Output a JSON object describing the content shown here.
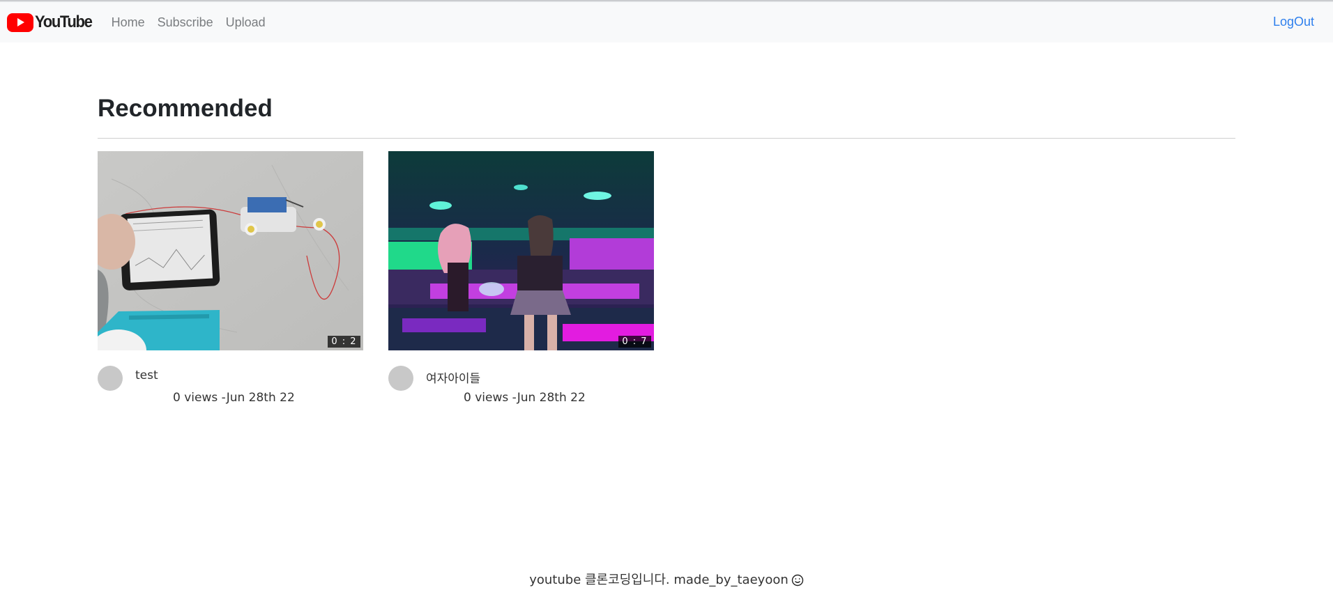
{
  "header": {
    "logo_text": "YouTube",
    "nav": [
      {
        "label": "Home"
      },
      {
        "label": "Subscribe"
      },
      {
        "label": "Upload"
      }
    ],
    "logout_label": "LogOut"
  },
  "main": {
    "title": "Recommended",
    "videos": [
      {
        "title": "test",
        "duration": "0 : 2",
        "stats": "0 views -Jun 28th 22"
      },
      {
        "title": "여자아이들",
        "duration": "0 : 7",
        "stats": "0 views -Jun 28th 22"
      }
    ]
  },
  "footer": {
    "text": "youtube 클론코딩입니다. made_by_taeyoon",
    "icon": "smiley-icon"
  },
  "colors": {
    "brand_red": "#ff0000",
    "link_blue": "#2f80ed",
    "nav_bg": "#f8f9fa",
    "nav_text": "#7a7d80"
  }
}
